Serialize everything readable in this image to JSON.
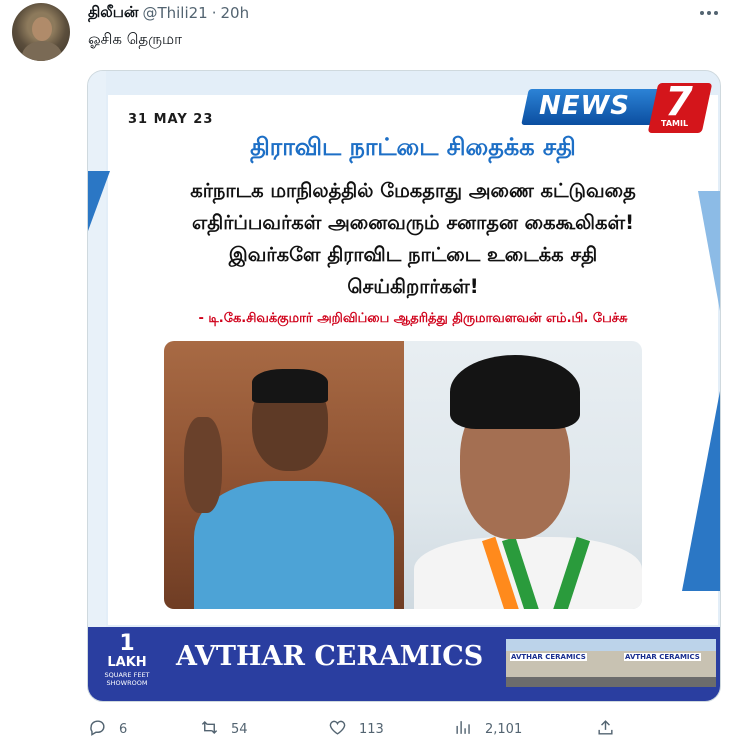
{
  "tweet": {
    "author_name": "திலீபன்",
    "handle": "@Thili21",
    "separator": "·",
    "time": "20h",
    "text": "ஓசிக தெருமா",
    "more_icon": "more-horizontal-icon"
  },
  "media": {
    "date": "31 MAY 23",
    "logo": {
      "news": "NEWS",
      "seven": "7",
      "tamil": "TAMIL"
    },
    "headline": "திராவிட நாட்டை சிதைக்க சதி",
    "body_lines": [
      "கர்நாடக மாநிலத்தில் மேகதாது அணை கட்டுவதை",
      "எதிர்ப்பவர்கள் அனைவரும் சனாதன கைகூலிகள்!",
      "இவர்களே திராவிட நாட்டை உடைக்க சதி",
      "செய்கிறார்கள்!"
    ],
    "source_line": "- டி.கே.சிவக்குமார் அறிவிப்பை ஆதரித்து திருமாவளவன் எம்.பி. பேச்சு",
    "ad": {
      "number": "1",
      "unit": "LAKH",
      "small1": "SQUARE FEET",
      "small2": "SHOWROOM",
      "name": "AVTHAR CERAMICS",
      "sign_left": "AVTHAR CERAMICS",
      "sign_right": "AVTHAR CERAMICS"
    },
    "colors": {
      "accent_blue": "#1d6fc6",
      "red": "#d0021b",
      "ad_bg": "#2a3ea0"
    }
  },
  "actions": {
    "replies": {
      "icon": "reply-icon",
      "count": "6"
    },
    "retweets": {
      "icon": "retweet-icon",
      "count": "54"
    },
    "likes": {
      "icon": "heart-icon",
      "count": "113"
    },
    "views": {
      "icon": "views-icon",
      "count": "2,101"
    },
    "share": {
      "icon": "share-icon"
    }
  }
}
